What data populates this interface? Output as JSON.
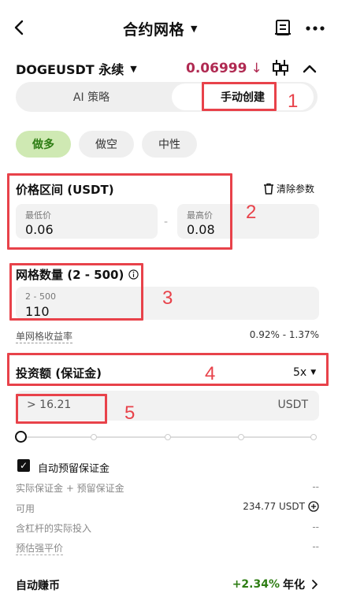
{
  "header": {
    "back_icon": "chevron-left-icon",
    "title": "合约网格",
    "title_caret": "▼",
    "doc_icon": "document-icon",
    "more_icon": "more-icon"
  },
  "ticker": {
    "pair": "DOGEUSDT 永续",
    "caret": "▼",
    "price": "0.06999",
    "price_arrow": "↓",
    "price_color": "#b02a52",
    "candle_icon": "candlestick-icon",
    "collapse_icon": "chevron-up-icon"
  },
  "mode_tabs": {
    "ai": "AI 策略",
    "manual": "手动创建",
    "active": "manual"
  },
  "direction": {
    "options": [
      "做多",
      "做空",
      "中性"
    ],
    "selected": "做多",
    "accent": "#2e7d14"
  },
  "price_range": {
    "title": "价格区间 (USDT)",
    "clear_label": "清除参数",
    "low_label": "最低价",
    "low_value": "0.06",
    "separator": "-",
    "high_label": "最高价",
    "high_value": "0.08"
  },
  "grid_count": {
    "title": "网格数量 (2 - 500)",
    "placeholder": "2 - 500",
    "value": "110"
  },
  "grid_yield": {
    "label": "单网格收益率",
    "value": "0.92% - 1.37%"
  },
  "investment": {
    "title": "投资额 (保证金)",
    "leverage": "5x",
    "leverage_caret": "▼",
    "input_value": "> 16.21",
    "unit": "USDT"
  },
  "slider": {
    "level": 0
  },
  "auto_margin": {
    "checked": true,
    "label": "自动预留保证金"
  },
  "info_rows": [
    {
      "label": "实际保证金 + 预留保证金",
      "value": "--"
    },
    {
      "label": "可用",
      "value": "234.77 USDT"
    },
    {
      "label": "含杠杆的实际投入",
      "value": "--"
    },
    {
      "label": "预估强平价",
      "value": "--"
    }
  ],
  "auto_earn": {
    "label": "自动赚币",
    "rate": "+2.34%",
    "rate_suffix": "年化",
    "rate_color": "#2e7d14"
  },
  "annotations": [
    "1",
    "2",
    "3",
    "4",
    "5"
  ]
}
